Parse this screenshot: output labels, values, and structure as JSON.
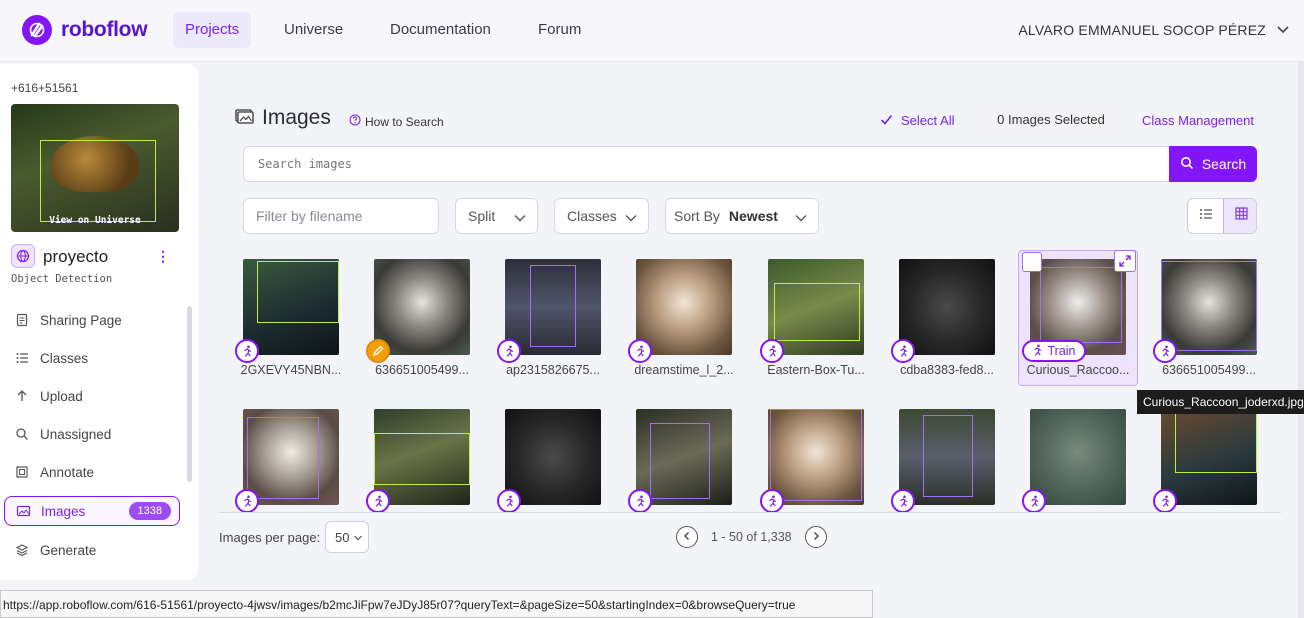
{
  "nav": {
    "logo_text": "roboflow",
    "tabs": [
      "Projects",
      "Universe",
      "Documentation",
      "Forum"
    ],
    "user_name": "ALVARO EMMANUEL SOCOP PÉREZ"
  },
  "sidebar": {
    "workspace": "+616+51561",
    "view_on_universe": "View on Universe",
    "project_name": "proyecto",
    "project_type": "Object Detection",
    "items": [
      {
        "label": "Sharing Page",
        "icon": "document-icon"
      },
      {
        "label": "Classes",
        "icon": "list-icon"
      },
      {
        "label": "Upload",
        "icon": "upload-arrow-icon"
      },
      {
        "label": "Unassigned",
        "icon": "search-icon"
      },
      {
        "label": "Annotate",
        "icon": "annotate-icon"
      },
      {
        "label": "Images",
        "icon": "images-icon",
        "badge": "1338",
        "active": true
      },
      {
        "label": "Generate",
        "icon": "layers-icon"
      }
    ]
  },
  "header": {
    "title": "Images",
    "how_to_search": "How to Search",
    "select_all": "Select All",
    "images_selected": "0 Images Selected",
    "class_management": "Class Management"
  },
  "search": {
    "placeholder": "Search images",
    "button": "Search"
  },
  "filters": {
    "filename_placeholder": "Filter by filename",
    "split": "Split",
    "classes": "Classes",
    "sort_by_label": "Sort By",
    "sort_by_value": "Newest"
  },
  "images": [
    {
      "name": "2GXEVY45NBN...",
      "status": "train"
    },
    {
      "name": "636651005499...",
      "status": "edit"
    },
    {
      "name": "ap2315826675...",
      "status": "train"
    },
    {
      "name": "dreamstime_l_2...",
      "status": "train"
    },
    {
      "name": "Eastern-Box-Tu...",
      "status": "train"
    },
    {
      "name": "cdba8383-fed8...",
      "status": "train"
    },
    {
      "name": "Curious_Raccoo...",
      "status": "train",
      "hover_label": "Train"
    },
    {
      "name": "636651005499...",
      "status": "train"
    },
    {
      "name": "",
      "status": "train"
    },
    {
      "name": "",
      "status": "train"
    },
    {
      "name": "",
      "status": "train"
    },
    {
      "name": "",
      "status": "train"
    },
    {
      "name": "",
      "status": "train"
    },
    {
      "name": "",
      "status": "train"
    },
    {
      "name": "",
      "status": "train"
    },
    {
      "name": "",
      "status": "train"
    }
  ],
  "tooltip": "Curious_Raccoon_joderxd.jpg",
  "pagination": {
    "per_page_label": "Images per page:",
    "per_page_value": "50",
    "range": "1 - 50 of 1,338"
  },
  "status_url": "https://app.roboflow.com/616-51561/proyecto-4jwsv/images/b2mcJiFpw7eJDyJ85r07?queryText=&pageSize=50&startingIndex=0&browseQuery=true",
  "colors": {
    "accent": "#8315f9",
    "accent_light": "#ece6fb",
    "edit_badge": "#f59e0b"
  }
}
